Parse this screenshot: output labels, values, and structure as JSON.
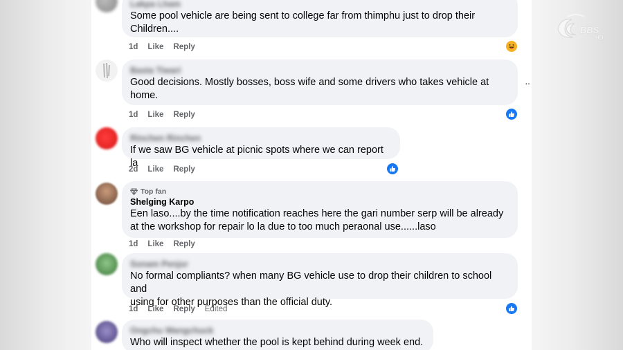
{
  "actions": {
    "like": "Like",
    "reply": "Reply",
    "edited": "Edited"
  },
  "top_fan_label": "Top fan",
  "logo": {
    "text": "BBS",
    "sub": "HD"
  },
  "comments": [
    {
      "author": "Lakpa Lham",
      "author_blurred": true,
      "text_lines": [
        "Some pool vehicle are being sent to college far from thimphu just to drop their",
        "Children...."
      ],
      "time": "1d",
      "reaction": "haha"
    },
    {
      "author": "Basta Tiwari",
      "author_blurred": true,
      "text_lines": [
        "Good decisions. Mostly bosses, boss wife and some drivers who takes vehicle at",
        "home."
      ],
      "time": "1d",
      "reaction": "like"
    },
    {
      "author": "Rinchen Rinchen",
      "author_blurred": true,
      "text_lines": [
        "If we saw BG vehicle at picnic spots where we can report la"
      ],
      "time": "2d",
      "reaction": "like"
    },
    {
      "author": "Shelging Karpo",
      "author_blurred": false,
      "top_fan": true,
      "text_lines": [
        "Een laso....by the time notification reaches here the gari number serp will be already",
        "at the workshop for repair lo la due to too much peraonal use......laso"
      ],
      "time": "1d",
      "reaction": ""
    },
    {
      "author": "Sonam Penjor",
      "author_blurred": true,
      "text_lines": [
        "No formal compliants? when many BG vehicle use to drop their children to school and",
        "using for other purposes than the official duty."
      ],
      "time": "1d",
      "reaction": "like",
      "edited": true
    },
    {
      "author": "Ongchu Wangchuck",
      "author_blurred": true,
      "text_lines": [
        "Who will inspect whether the pool is kept behind during week end."
      ],
      "time": "",
      "reaction": ""
    }
  ]
}
